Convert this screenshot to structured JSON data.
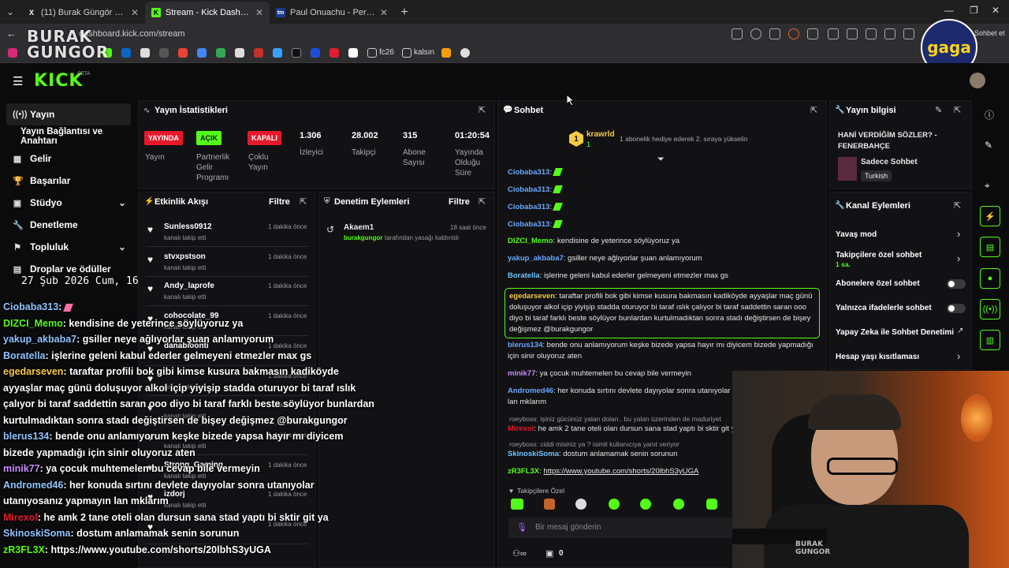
{
  "browser": {
    "tabs": [
      {
        "title": "(11) Burak Güngör (@gungorburak",
        "favicon": "X",
        "active": false
      },
      {
        "title": "Stream - Kick Dashboard",
        "favicon": "K",
        "active": true
      },
      {
        "title": "Paul Onuachu - Performans bilgile",
        "favicon": "tm",
        "active": false
      }
    ],
    "url": "dashboard.kick.com/stream",
    "bookmarks": [
      "fc26",
      "kalsın"
    ],
    "right_label": "Sohbet et"
  },
  "watermark": {
    "line1": "BURAK",
    "line2": "GUNGOR",
    "badge": "gaga"
  },
  "clock": "27 Şub 2026 Cum, 16:07",
  "kick": {
    "logo": "KICK",
    "beta": "BETA"
  },
  "nav": {
    "items": [
      {
        "label": "Yayın",
        "icon": "((•))",
        "selected": true
      },
      {
        "label": "Yayın Bağlantısı ve Anahtarı",
        "icon": "",
        "selected": false
      },
      {
        "label": "Gelir",
        "icon": "▦",
        "selected": false
      },
      {
        "label": "Başarılar",
        "icon": "🏆",
        "selected": false
      },
      {
        "label": "Stüdyo",
        "icon": "▣",
        "selected": false
      },
      {
        "label": "Denetleme",
        "icon": "🔧",
        "selected": false
      },
      {
        "label": "Topluluk",
        "icon": "⚑",
        "selected": false
      },
      {
        "label": "Droplar ve ödüller",
        "icon": "▤",
        "selected": false
      }
    ]
  },
  "stats": {
    "title": "Yayın İstatistikleri",
    "items": [
      {
        "badge": "YAYINDA",
        "label": "Yayın"
      },
      {
        "badge": "AÇIK",
        "label": "Partnerlik Gelir Programı"
      },
      {
        "badge": "KAPALI",
        "label": "Çoklu Yayın"
      },
      {
        "value": "1.306",
        "label": "İzleyici"
      },
      {
        "value": "28.002",
        "label": "Takipçi"
      },
      {
        "value": "315",
        "label": "Abone Sayısı"
      },
      {
        "value": "01:20:54",
        "label": "Yayında Olduğu Süre"
      }
    ]
  },
  "activity": {
    "title": "Etkinlik Akışı",
    "filter": "Filtre",
    "events": [
      {
        "name": "Sunless0912",
        "action": "kanalı takip etti",
        "time": "1 dakika önce"
      },
      {
        "name": "stvxpstson",
        "action": "kanalı takip etti",
        "time": "1 dakika önce"
      },
      {
        "name": "Andy_laprofe",
        "action": "kanalı takip etti",
        "time": "1 dakika önce"
      },
      {
        "name": "cohocolate_99",
        "action": "kanalı takip etti",
        "time": "1 dakika önce"
      },
      {
        "name": "danabioonti",
        "action": "kanalı takip etti",
        "time": "1 dakika önce"
      },
      {
        "name": "",
        "action": "kanalı takip etti",
        "time": "1 dakika önce"
      },
      {
        "name": "",
        "action": "kanalı takip etti",
        "time": "1 dakika önce"
      },
      {
        "name": "",
        "action": "kanalı takip etti",
        "time": "1 dakika önce"
      },
      {
        "name": "Strong_Gaming",
        "action": "kanalı takip etti",
        "time": "1 dakika önce"
      },
      {
        "name": "izdorj",
        "action": "kanalı takip etti",
        "time": "1 dakika önce"
      },
      {
        "name": "",
        "action": "",
        "time": "1 dakika önce"
      }
    ]
  },
  "moderation": {
    "title": "Denetim Eylemleri",
    "filter": "Filtre",
    "entries": [
      {
        "actor": "Akaem1",
        "time": "18 saat önce",
        "target": "burakgungor",
        "text": "tarafından yasağı kaldırıldı"
      }
    ]
  },
  "chat": {
    "title": "Sohbet",
    "top_gifter": {
      "name": "krawrld",
      "rank": "1",
      "count": "1",
      "note": "1 abonelik hediye ederek 2. sıraya yükselin"
    },
    "messages": [
      {
        "user": "Ciobaba313",
        "color": "#6aa7ff",
        "text": ""
      },
      {
        "user": "Ciobaba313",
        "color": "#6aa7ff",
        "text": ""
      },
      {
        "user": "Ciobaba313",
        "color": "#6aa7ff",
        "text": ""
      },
      {
        "user": "Ciobaba313",
        "color": "#6aa7ff",
        "text": ""
      },
      {
        "user": "DIZCI_Memo",
        "color": "#53fc18",
        "text": "kendisine de yeterince söylüyoruz ya"
      },
      {
        "user": "yakup_akbaba7",
        "color": "#6aa7ff",
        "text": "gsiller neye ağlıyorlar şuan anlamıyorum"
      },
      {
        "user": "Boratella",
        "color": "#6ec3ff",
        "text": "işlerine geleni kabul ederler gelmeyeni etmezler max gs"
      },
      {
        "user": "egedarseven",
        "color": "#f6c945",
        "text": "taraftar profili bok gibi kimse kusura bakmasın kadiköyde ayyaşlar maç günü doluşuyor alkol içip yiyişip stadda oturuyor bi taraf ıslık çalıyor bi taraf saddettin saran ooo diyo bi taraf farklı beste söylüyor bunlardan kurtulmadıktan sonra stadı değiştirsen de bişey değişmez @burakgungor"
      },
      {
        "user": "blerus134",
        "color": "#6aa7ff",
        "text": "bende onu anlamıyorum keşke bizede yapsa hayır mı diyicem bizede yapmadığı için sinir oluyoruz aten"
      },
      {
        "user": "minik77",
        "color": "#c78cff",
        "text": "ya çocuk muhtemelen bu cevap bile vermeyin"
      },
      {
        "user": "Andromed46",
        "color": "#6aa7ff",
        "text": "her konuda sırtını devlete dayıyolar sonra utanıyolar utanıyosanız yapmayın lan mklarım"
      },
      {
        "user": "Mirexol",
        "color": "#e6192b",
        "text": "he amk 2 tane oteli olan dursun sana stad yaptı bi sktir git ya"
      },
      {
        "user": "SkinoskiSoma",
        "color": "#6ec3ff",
        "text": "dostum anlamamak senin sorunun"
      },
      {
        "user": "zR3FL3X",
        "color": "#53fc18",
        "text": "https://www.youtube.com/shorts/20lbhS3yUGA"
      }
    ],
    "replies": [
      "roeyboss: işiniz gücünüz yalan dolan.. bu yalan üzerinden de maduriyet",
      "roeyboss: ciddi misiniz ya ? isimli kullanıcıya yanıt veriyor"
    ],
    "emote_label": "Takipçilere Özel",
    "input_placeholder": "Bir mesaj gönderin",
    "footer_count": "0"
  },
  "stream_info": {
    "title": "Yayın bilgisi",
    "stream_title": "HANİ VERDİĞİM SÖZLER? - FENERBAHÇE",
    "category": "Sadece Sohbet",
    "language": "Turkish"
  },
  "channel_actions": {
    "title": "Kanal Eylemleri",
    "items": [
      {
        "label": "Yavaş mod",
        "control": "chevron",
        "sub": ""
      },
      {
        "label": "Takipçilere özel sohbet",
        "control": "chevron",
        "sub": "1 sa."
      },
      {
        "label": "Abonelere özel sohbet",
        "control": "toggle",
        "sub": ""
      },
      {
        "label": "Yalnızca ifadelerle sohbet",
        "control": "toggle",
        "sub": ""
      },
      {
        "label": "Yapay Zeka ile Sohbet Denetimi",
        "control": "external",
        "sub": ""
      },
      {
        "label": "Hesap yaşı kısıtlaması",
        "control": "chevron",
        "sub": ""
      }
    ]
  },
  "overlay": {
    "lines": [
      {
        "user": "Ciobaba313",
        "color": "#8fc4ff",
        "text": ""
      },
      {
        "user": "DIZCI_Memo",
        "color": "#53fc18",
        "text": "kendisine de yeterince söylüyoruz ya"
      },
      {
        "user": "yakup_akbaba7",
        "color": "#8fc4ff",
        "text": "gsiller neye ağlıyorlar şuan anlamıyorum"
      },
      {
        "user": "Boratella",
        "color": "#8fc4ff",
        "text": "işlerine geleni kabul ederler gelmeyeni etmezler max gs"
      },
      {
        "user": "egedarseven",
        "color": "#f6c945",
        "text": "taraftar profili bok gibi kimse kusura bakmasın kadiköyde"
      },
      {
        "user": "",
        "color": "#ffffff",
        "text": "ayyaşlar maç günü doluşuyor alkol içip yiyişip stadda oturuyor bi taraf ıslık"
      },
      {
        "user": "",
        "color": "#ffffff",
        "text": "çalıyor bi taraf saddettin saran ooo diyo bi taraf farklı beste söylüyor bunlardan"
      },
      {
        "user": "",
        "color": "#ffffff",
        "text": "kurtulmadıktan sonra stadı değiştirsen de bişey değişmez @burakgungor"
      },
      {
        "user": "blerus134",
        "color": "#8fc4ff",
        "text": "bende onu anlamıyorum keşke bizede yapsa hayır mı diyicem"
      },
      {
        "user": "",
        "color": "#ffffff",
        "text": "bizede yapmadığı için sinir oluyoruz aten"
      },
      {
        "user": "minik77",
        "color": "#c78cff",
        "text": "ya çocuk muhtemelen bu cevap bile vermeyin"
      },
      {
        "user": "Andromed46",
        "color": "#8fc4ff",
        "text": "her konuda sırtını devlete dayıyolar sonra utanıyolar"
      },
      {
        "user": "",
        "color": "#ffffff",
        "text": "utanıyosanız yapmayın lan mklarım"
      },
      {
        "user": "Mirexol",
        "color": "#e6192b",
        "text": "he amk 2 tane oteli olan dursun sana stad yaptı bi sktir git ya"
      },
      {
        "user": "SkinoskiSoma",
        "color": "#8fc4ff",
        "text": "dostum anlamamak senin sorunun"
      },
      {
        "user": "zR3FL3X",
        "color": "#53fc18",
        "text": "https://www.youtube.com/shorts/20lbhS3yUGA"
      }
    ]
  },
  "webcam": {
    "shirt_text_1": "BURAK",
    "shirt_text_2": "GUNGOR"
  }
}
